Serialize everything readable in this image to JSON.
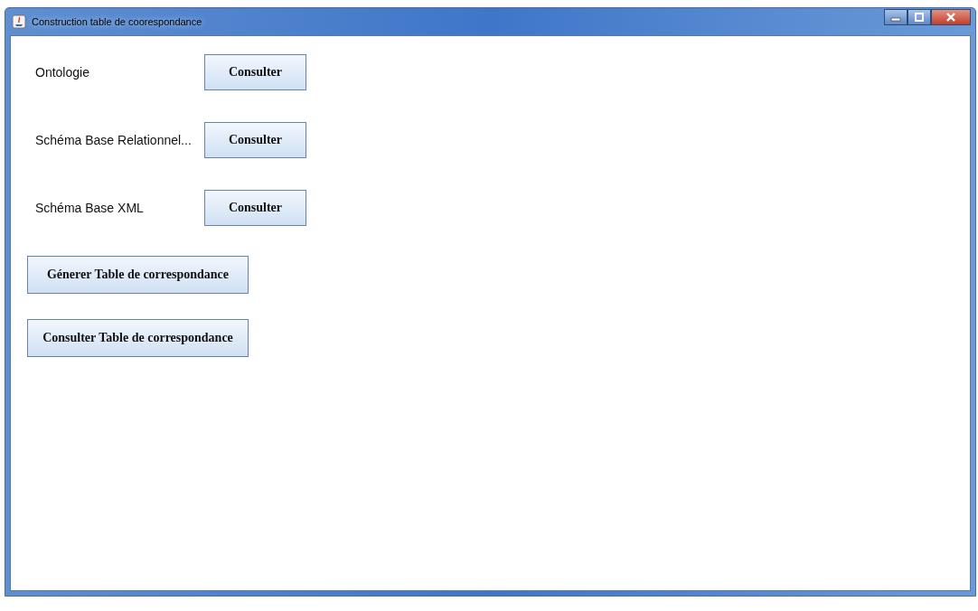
{
  "window": {
    "title": "Construction table de coorespondance"
  },
  "rows": [
    {
      "label": "Ontologie",
      "button": "Consulter"
    },
    {
      "label": "Schéma Base Relationnel...",
      "button": "Consulter"
    },
    {
      "label": "Schéma Base XML",
      "button": "Consulter"
    }
  ],
  "actions": [
    "Génerer Table de correspondance",
    "Consulter Table de correspondance"
  ]
}
